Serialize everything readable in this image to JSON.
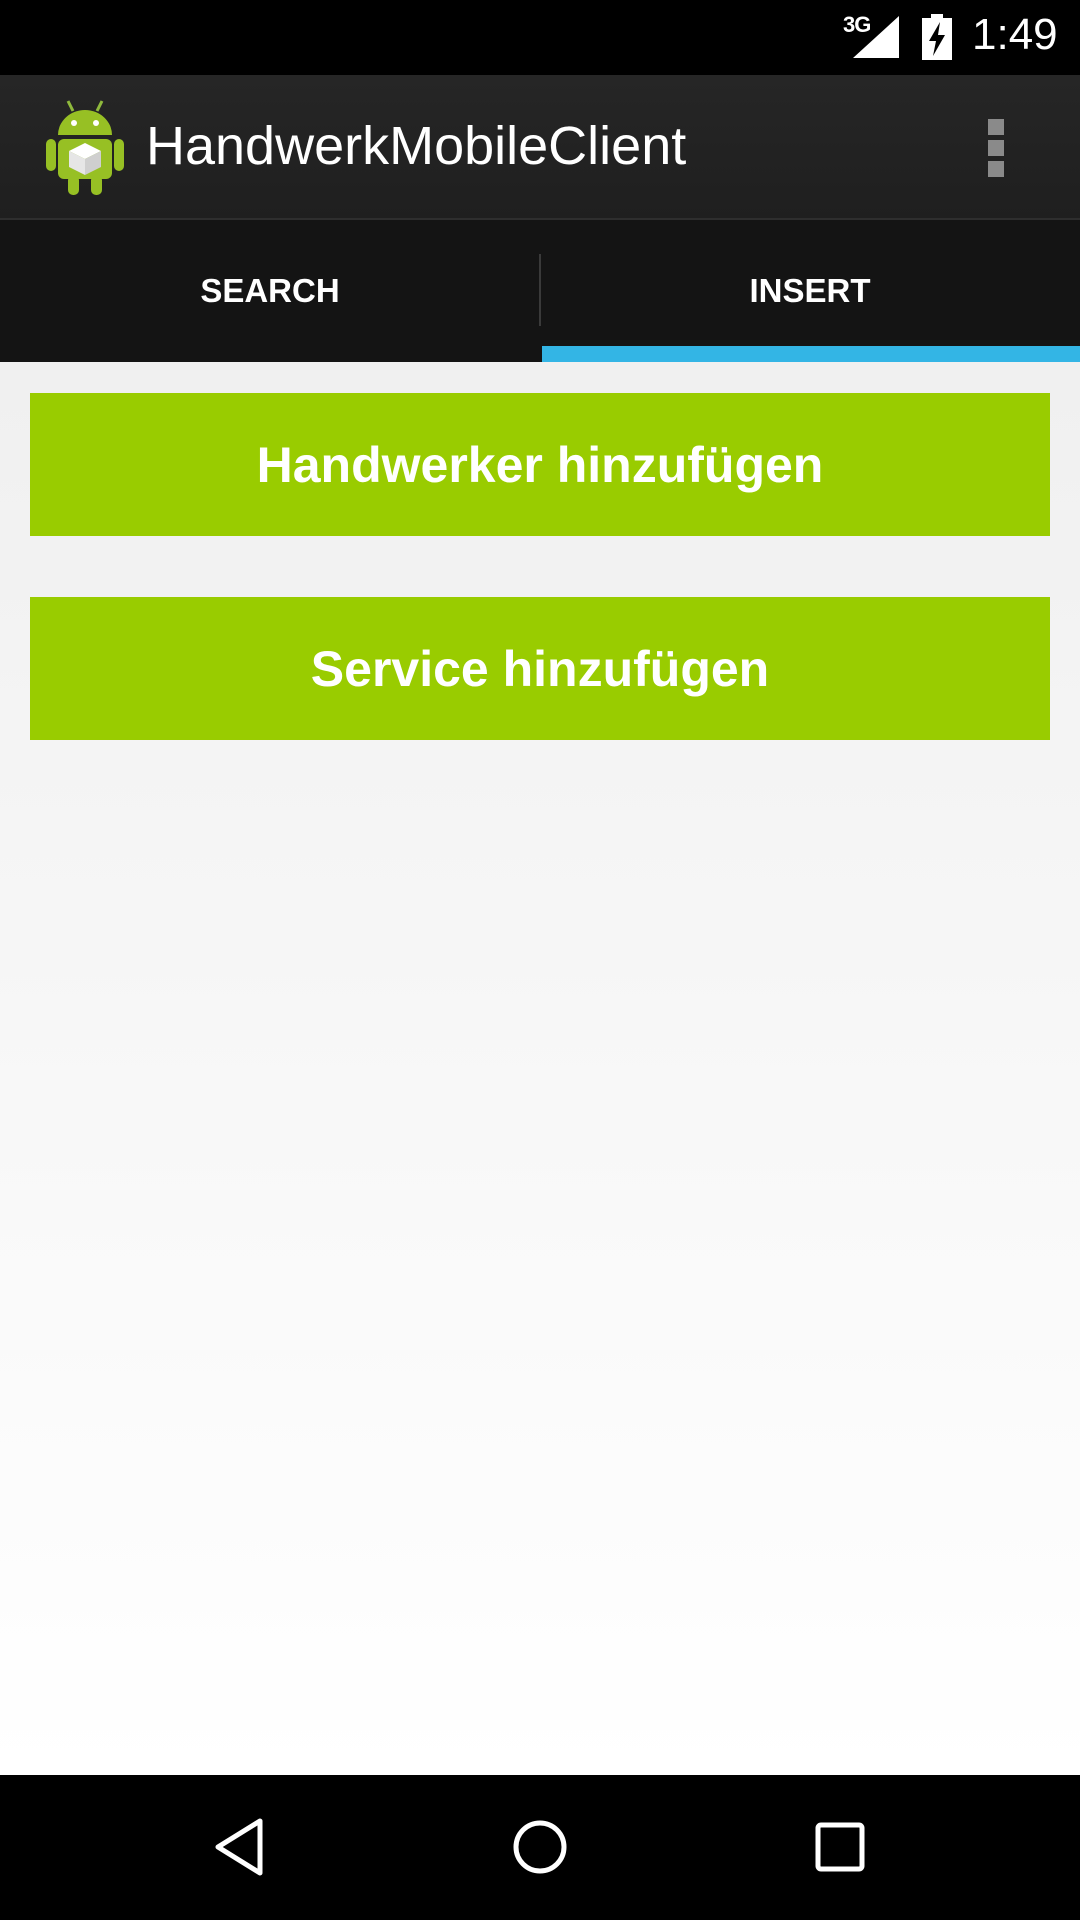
{
  "status_bar": {
    "network_label": "3G",
    "time": "1:49",
    "icons": [
      "signal-icon",
      "battery-charging-icon"
    ]
  },
  "action_bar": {
    "app_icon": "android-robot-icon",
    "title": "HandwerkMobileClient",
    "overflow_icon": "overflow-menu-icon"
  },
  "tabs": [
    {
      "label": "SEARCH",
      "selected": false
    },
    {
      "label": "INSERT",
      "selected": true
    }
  ],
  "main": {
    "buttons": [
      {
        "label": "Handwerker hinzufügen"
      },
      {
        "label": "Service hinzufügen"
      }
    ]
  },
  "nav_bar": {
    "icons": [
      "back-icon",
      "home-icon",
      "recents-icon"
    ]
  },
  "colors": {
    "accent": "#33b5e5",
    "button_green": "#99cc00",
    "action_bar": "#222222",
    "tab_bar": "#141414"
  }
}
